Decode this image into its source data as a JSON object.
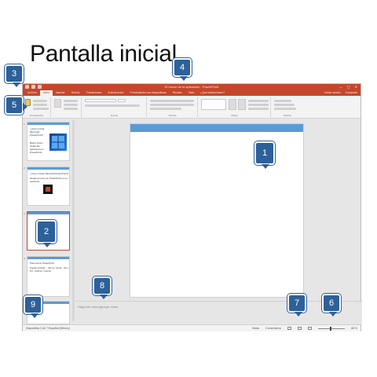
{
  "heading": "Pantalla inicial",
  "window": {
    "doc_title": "El rincón de la aplicación - PowerPoint",
    "controls": [
      "—",
      "▢",
      "✕"
    ]
  },
  "tabs": [
    "Archivo",
    "Inicio",
    "Insertar",
    "Diseño",
    "Transiciones",
    "Animaciones",
    "Presentación con diapositivas",
    "Revisar",
    "Vista",
    "¿Qué desea hacer?"
  ],
  "active_tab": "Inicio",
  "tab_right": [
    "Iniciar sesión",
    "Compartir"
  ],
  "ribbon_groups": [
    "Portapapeles",
    "Fuente",
    "Párrafo",
    "Dibujo",
    "Edición"
  ],
  "thumbnails": [
    {
      "num": "1",
      "title": "¿Cómo iniciar Microsoft PowerPoint?",
      "body": "Botón Inicio / Todas las aplicaciones / PowerPoint"
    },
    {
      "num": "2",
      "title": "¿Cómo iniciar Microsoft PowerPoint?",
      "body": "Desde el icono de PowerPoint en el escritorio"
    },
    {
      "num": "3",
      "title": "",
      "body": ""
    },
    {
      "num": "4",
      "title": "Para cerrar PowerPoint",
      "body": "Puede hacerlo: · Clic en cerrar · Alt + F4 · Archivo / Cerrar"
    }
  ],
  "notes_placeholder": "Haga clic para agregar notas",
  "status": {
    "left": "Diapositiva 3 de 7     Español (México)",
    "notes": "Notas",
    "comments": "Comentarios",
    "zoom": "68 %"
  },
  "callouts": [
    "1",
    "2",
    "3",
    "4",
    "5",
    "6",
    "7",
    "8",
    "9"
  ],
  "colors": {
    "accent": "#c5472b",
    "callout": "#2e6099",
    "slide_bar": "#5b9bd5"
  }
}
